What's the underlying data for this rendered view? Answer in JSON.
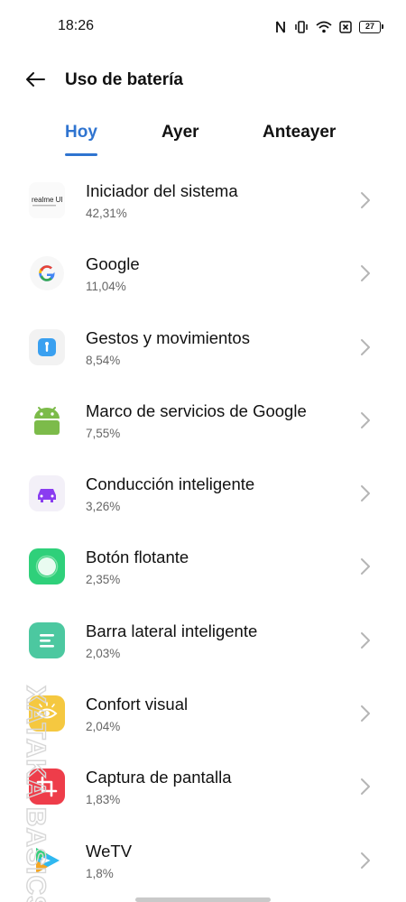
{
  "status_bar": {
    "time": "18:26",
    "battery_level": "27",
    "icons": [
      "nfc-icon",
      "vibrate-icon",
      "wifi-icon",
      "sim-icon",
      "battery-icon"
    ]
  },
  "header": {
    "title": "Uso de batería",
    "back_icon": "arrow-left-icon"
  },
  "tabs": [
    {
      "label": "Hoy",
      "active": true
    },
    {
      "label": "Ayer",
      "active": false
    },
    {
      "label": "Anteayer",
      "active": false
    }
  ],
  "apps": [
    {
      "name": "Iniciador del sistema",
      "percent": "42,31%",
      "icon": "realme-ui-icon",
      "icon_text": "realme UI"
    },
    {
      "name": "Google",
      "percent": "11,04%",
      "icon": "google-icon"
    },
    {
      "name": "Gestos y movimientos",
      "percent": "8,54%",
      "icon": "gestures-icon"
    },
    {
      "name": "Marco de servicios de Google",
      "percent": "7,55%",
      "icon": "android-icon"
    },
    {
      "name": "Conducción inteligente",
      "percent": "3,26%",
      "icon": "car-icon"
    },
    {
      "name": "Botón flotante",
      "percent": "2,35%",
      "icon": "floating-button-icon"
    },
    {
      "name": "Barra lateral inteligente",
      "percent": "2,03%",
      "icon": "sidebar-icon"
    },
    {
      "name": "Confort visual",
      "percent": "2,04%",
      "icon": "eye-icon"
    },
    {
      "name": "Captura de pantalla",
      "percent": "1,83%",
      "icon": "crop-icon"
    },
    {
      "name": "WeTV",
      "percent": "1,8%",
      "icon": "wetv-icon"
    }
  ],
  "colors": {
    "accent": "#2f74d0",
    "text": "#111111",
    "secondary_text": "#666666",
    "chevron": "#b5b5b5"
  },
  "watermark": "XATAKA BASICS"
}
